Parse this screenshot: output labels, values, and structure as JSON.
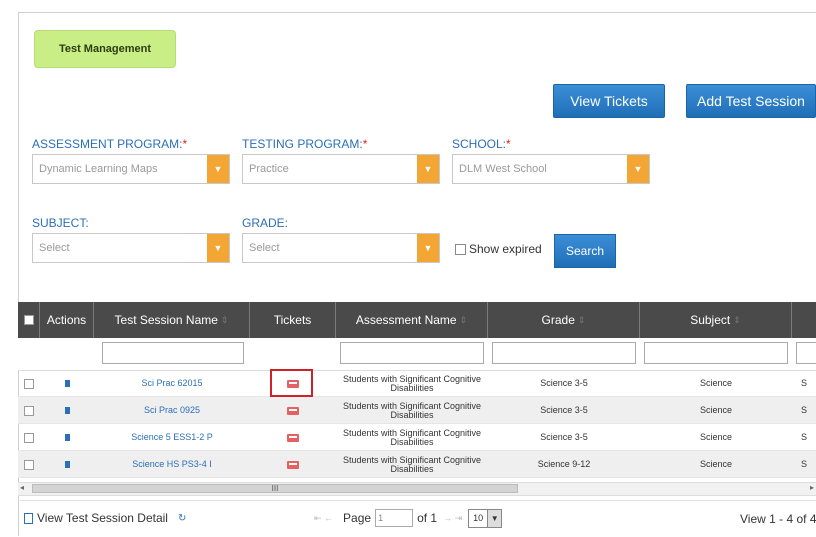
{
  "header": {
    "tab_label": "Test Management",
    "view_tickets_label": "View Tickets",
    "add_test_session_label": "Add Test Session"
  },
  "filters": {
    "assessment_program": {
      "label": "ASSESSMENT PROGRAM:",
      "required": "*",
      "value": "Dynamic Learning Maps"
    },
    "testing_program": {
      "label": "TESTING PROGRAM:",
      "required": "*",
      "value": "Practice"
    },
    "school": {
      "label": "SCHOOL:",
      "required": "*",
      "value": "DLM West School"
    },
    "subject": {
      "label": "SUBJECT:",
      "value": "Select"
    },
    "grade": {
      "label": "GRADE:",
      "value": "Select"
    },
    "show_expired_label": "Show expired",
    "search_label": "Search"
  },
  "grid": {
    "columns": [
      "Actions",
      "Test Session Name",
      "Tickets",
      "Assessment Name",
      "Grade",
      "Subject"
    ],
    "rows": [
      {
        "name": "Sci Prac 62015",
        "assessment": "Students with Significant Cognitive Disabilities",
        "grade": "Science 3-5",
        "subject": "Science",
        "extra": "S"
      },
      {
        "name": "Sci Prac 0925",
        "assessment": "Students with Significant Cognitive Disabilities",
        "grade": "Science 3-5",
        "subject": "Science",
        "extra": "S"
      },
      {
        "name": "Science 5 ESS1-2 P",
        "assessment": "Students with Significant Cognitive Disabilities",
        "grade": "Science 3-5",
        "subject": "Science",
        "extra": "S"
      },
      {
        "name": "Science HS PS3-4 I",
        "assessment": "Students with Significant Cognitive Disabilities",
        "grade": "Science 9-12",
        "subject": "Science",
        "extra": "S"
      }
    ],
    "scroll_thumb_label": "III"
  },
  "footer": {
    "view_detail_label": "View Test Session Detail",
    "page_label": "Page",
    "page_value": "1",
    "of_label": "of 1",
    "rows_per_page": "10",
    "record_info": "View 1 - 4 of 4"
  }
}
